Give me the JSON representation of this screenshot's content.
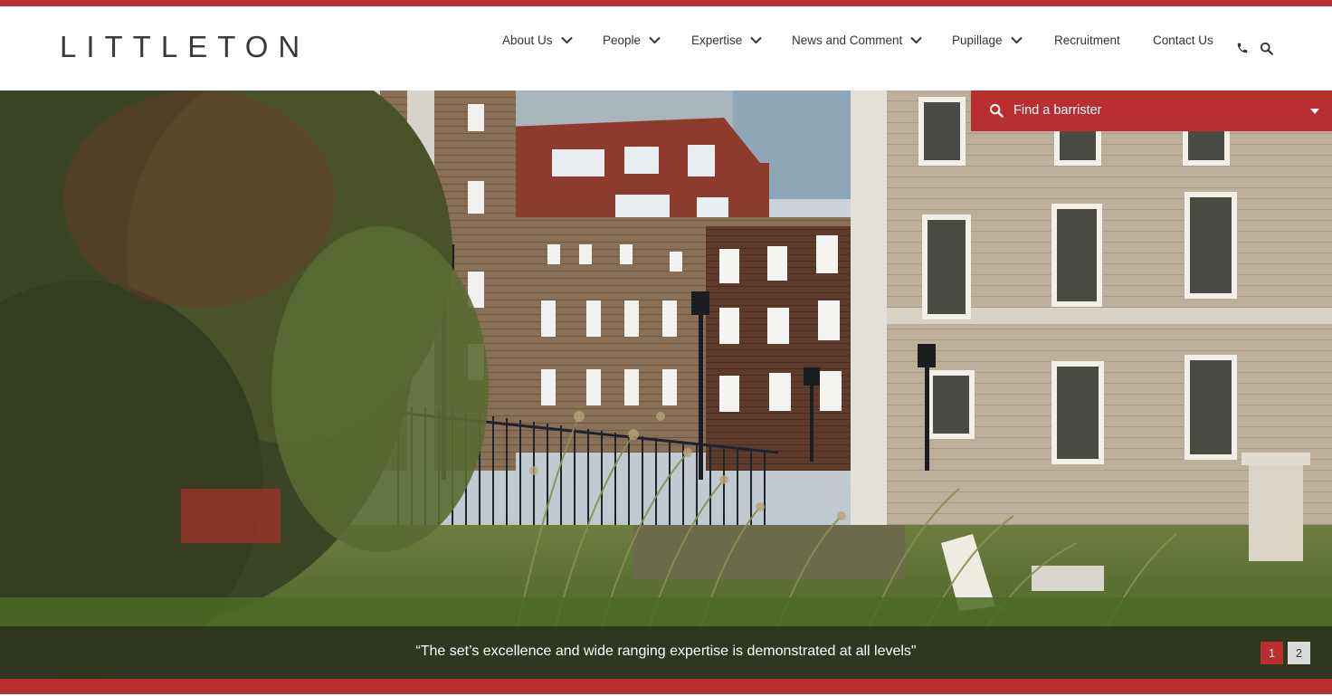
{
  "brand": {
    "logo_text": "LITTLETON",
    "accent_color": "#b92e2e"
  },
  "nav": {
    "items": [
      {
        "label": "About Us",
        "has_dropdown": true
      },
      {
        "label": "People",
        "has_dropdown": true
      },
      {
        "label": "Expertise",
        "has_dropdown": true
      },
      {
        "label": "News and Comment",
        "has_dropdown": true
      },
      {
        "label": "Pupillage",
        "has_dropdown": true
      },
      {
        "label": "Recruitment",
        "has_dropdown": false
      },
      {
        "label": "Contact Us",
        "has_dropdown": false
      }
    ],
    "icons": [
      "phone-icon",
      "search-icon"
    ]
  },
  "finder": {
    "label": "Find a barrister",
    "icon": "search-icon",
    "caret": "caret-down-icon"
  },
  "hero": {
    "quote": "“The set’s excellence and wide ranging expertise is demonstrated at all levels\"",
    "slides": [
      {
        "label": "1",
        "active": true
      },
      {
        "label": "2",
        "active": false
      }
    ]
  }
}
